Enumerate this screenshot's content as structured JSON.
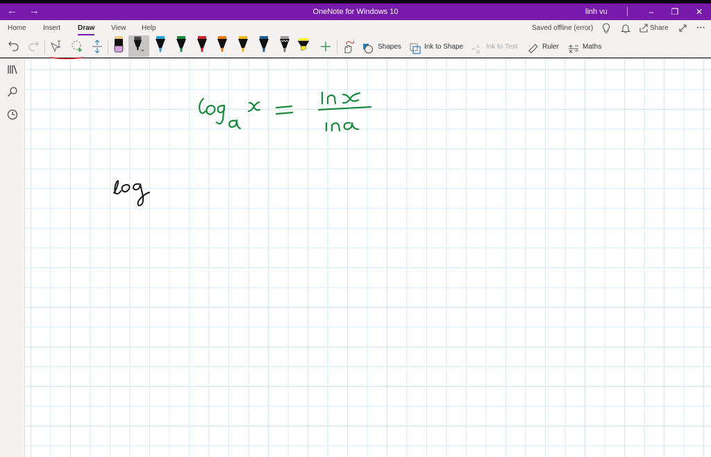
{
  "titlebar": {
    "title": "OneNote for Windows 10",
    "user": "linh vu",
    "back_icon": "arrow-left-icon",
    "forward_icon": "arrow-right-icon",
    "minimize_glyph": "–",
    "restore_glyph": "❐",
    "close_glyph": "✕",
    "back_glyph": "←",
    "forward_glyph": "→"
  },
  "ribbon": {
    "tabs": [
      {
        "label": "Home"
      },
      {
        "label": "Insert"
      },
      {
        "label": "Draw",
        "active": true
      },
      {
        "label": "View"
      },
      {
        "label": "Help"
      }
    ],
    "status": "Saved offline (error)",
    "share_label": "Share",
    "more_glyph": "···",
    "tools": {
      "shapes": "Shapes",
      "ink_to_shape": "Ink to Shape",
      "ink_to_text": "Ink to Text",
      "ruler": "Ruler",
      "maths": "Maths"
    },
    "pens": [
      {
        "name": "eraser",
        "color": "#d7a0e0"
      },
      {
        "name": "black-pen-selected",
        "color": "#222222"
      },
      {
        "name": "blue-pen",
        "color": "#2aa3d8"
      },
      {
        "name": "green-pen",
        "color": "#1f8a3f"
      },
      {
        "name": "red-pen",
        "color": "#d4222a"
      },
      {
        "name": "orange-pen",
        "color": "#ef7b1c"
      },
      {
        "name": "yellow-pen",
        "color": "#f1b51c"
      },
      {
        "name": "navy-pen",
        "color": "#1d5c8c"
      },
      {
        "name": "galaxy-pen",
        "color": "#9a9a9a"
      },
      {
        "name": "highlighter",
        "color": "#ffef2a"
      }
    ]
  },
  "canvas": {
    "ink_equation": "log_a x = ln x / ln a",
    "ink_note": "log",
    "ink_colors": {
      "green": "#1a8a3c",
      "black": "#1a1a1a"
    }
  },
  "colors": {
    "accent": "#7719aa",
    "grid": "#d6ebf3"
  }
}
